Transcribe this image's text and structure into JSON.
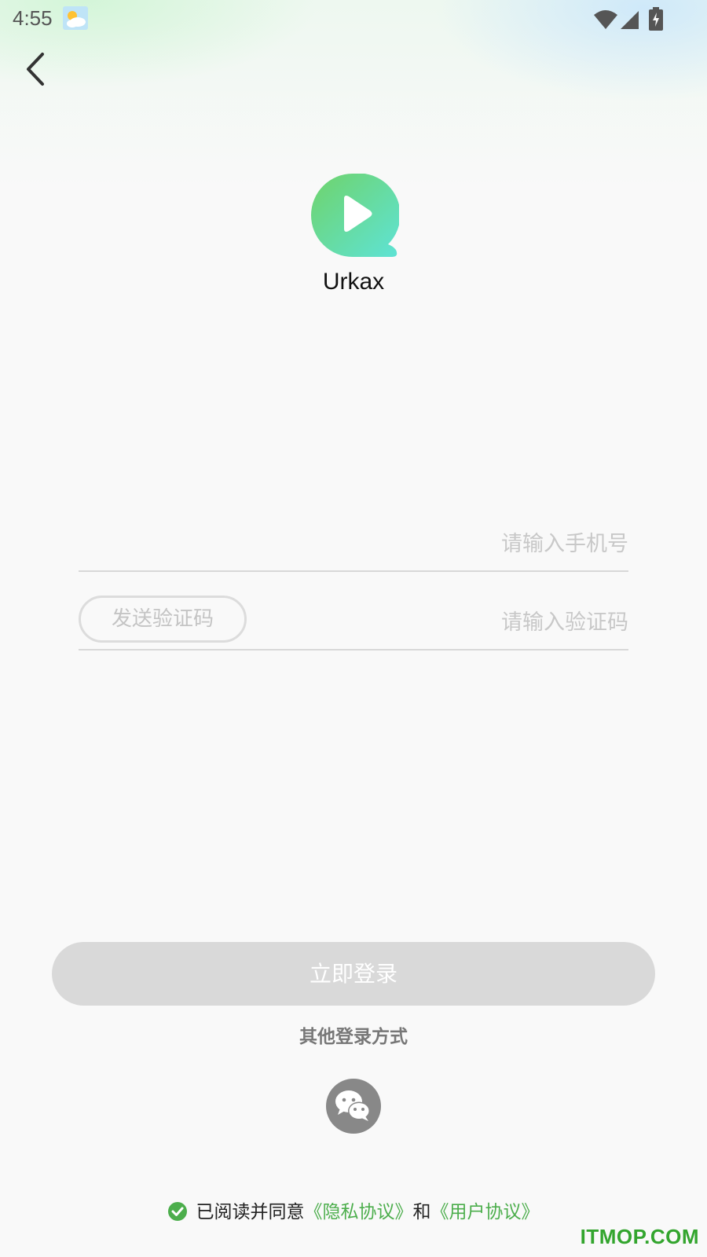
{
  "status_bar": {
    "time": "4:55",
    "icons": [
      "weather-icon",
      "wifi-icon",
      "signal-icon",
      "battery-icon"
    ]
  },
  "header": {
    "back_icon": "chevron-left-icon"
  },
  "app": {
    "name": "Urkax",
    "logo_icon": "play-bubble-logo",
    "colors": {
      "logo_start": "#6fd36a",
      "logo_end": "#5ee3d6"
    }
  },
  "form": {
    "phone": {
      "value": "",
      "placeholder": "请输入手机号"
    },
    "code": {
      "value": "",
      "placeholder": "请输入验证码"
    },
    "send_code_label": "发送验证码"
  },
  "login_button": {
    "label": "立即登录",
    "color": "#d9d9d9"
  },
  "other_login": {
    "label": "其他登录方式",
    "options": [
      {
        "icon": "wechat-icon"
      }
    ]
  },
  "agreement": {
    "checked": true,
    "prefix": "已阅读并同意",
    "privacy_link": "《隐私协议》",
    "and": "和",
    "user_link": "《用户协议》",
    "link_color": "#4cae4c"
  },
  "watermark": "ITMOP.COM"
}
